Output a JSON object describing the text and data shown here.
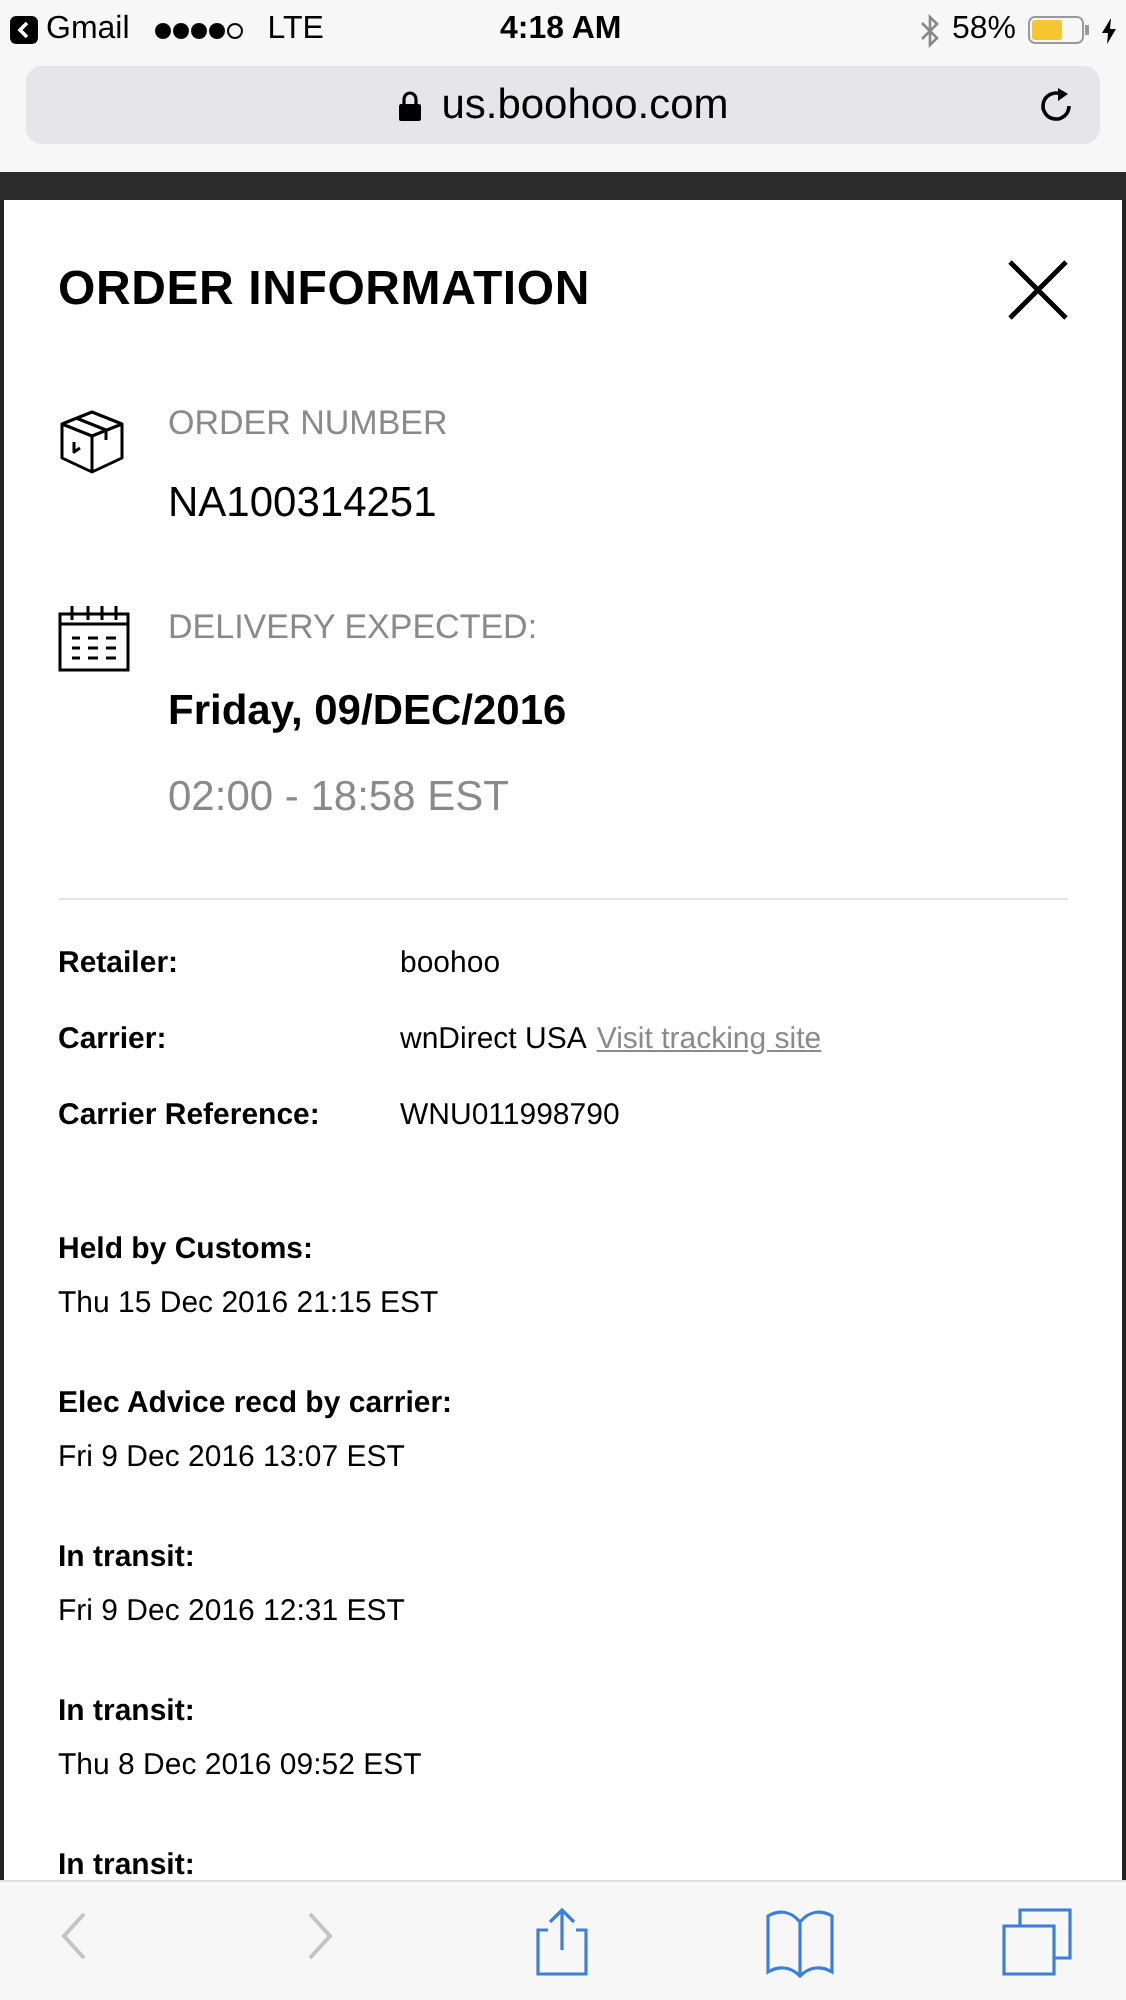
{
  "status_bar": {
    "back_app": "Gmail",
    "carrier": "LTE",
    "time": "4:18 AM",
    "battery": "58%"
  },
  "address_bar": {
    "url": "us.boohoo.com"
  },
  "modal": {
    "title": "ORDER INFORMATION",
    "order": {
      "label": "ORDER NUMBER",
      "value": "NA100314251"
    },
    "delivery": {
      "label": "DELIVERY EXPECTED:",
      "date": "Friday, 09/DEC/2016",
      "window": "02:00 - 18:58 EST"
    },
    "details": [
      {
        "label": "Retailer:",
        "value": "boohoo"
      },
      {
        "label": "Carrier:",
        "value": "wnDirect USA",
        "link": "Visit tracking site"
      },
      {
        "label": "Carrier Reference:",
        "value": "WNU011998790"
      }
    ],
    "events": [
      {
        "status": "Held by Customs:",
        "time": "Thu 15 Dec 2016 21:15 EST"
      },
      {
        "status": "Elec Advice recd by carrier:",
        "time": "Fri 9 Dec 2016 13:07 EST"
      },
      {
        "status": "In transit:",
        "time": "Fri 9 Dec 2016 12:31 EST"
      },
      {
        "status": "In transit:",
        "time": "Thu 8 Dec 2016 09:52 EST"
      },
      {
        "status": "In transit:"
      }
    ]
  },
  "toolbar": [
    {
      "kind": "back",
      "disabled": true
    },
    {
      "kind": "forward",
      "disabled": true
    },
    {
      "kind": "share",
      "disabled": false
    },
    {
      "kind": "bookmarks",
      "disabled": false
    },
    {
      "kind": "tabs",
      "disabled": false
    }
  ]
}
